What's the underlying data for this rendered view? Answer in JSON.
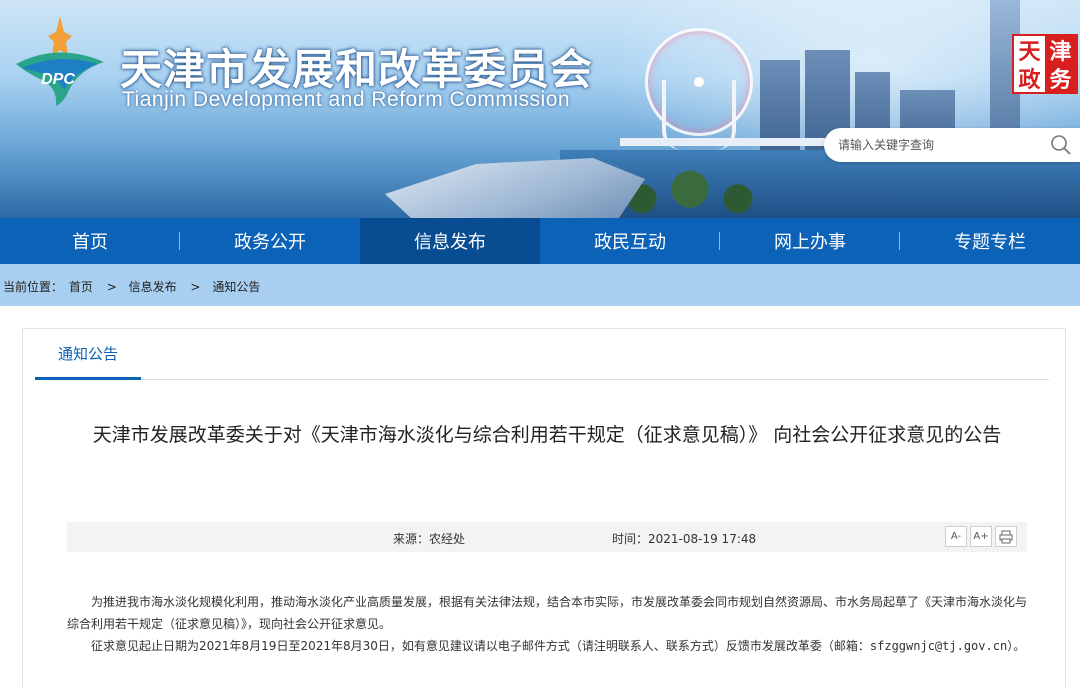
{
  "header": {
    "logo_text": "DPC",
    "title_cn": "天津市发展和改革委员会",
    "title_en": "Tianjin Development and Reform Commission",
    "seal_chars": [
      "天",
      "津",
      "政",
      "务"
    ]
  },
  "search": {
    "placeholder": "请输入关键字查询"
  },
  "nav": {
    "items": [
      {
        "label": "首页"
      },
      {
        "label": "政务公开"
      },
      {
        "label": "信息发布"
      },
      {
        "label": "政民互动"
      },
      {
        "label": "网上办事"
      },
      {
        "label": "专题专栏"
      }
    ],
    "active_index": 2
  },
  "breadcrumb": {
    "prefix": "当前位置：",
    "items": [
      "首页",
      "信息发布",
      "通知公告"
    ],
    "separator": ">"
  },
  "panel": {
    "tab_label": "通知公告"
  },
  "article": {
    "title": "天津市发展改革委关于对《天津市海水淡化与综合利用若干规定（征求意见稿）》 向社会公开征求意见的公告",
    "source": "来源：农经处",
    "time": "时间：2021-08-19 17:48",
    "tools": {
      "font_smaller": "A-",
      "font_larger": "A+"
    },
    "para1": "为推进我市海水淡化规模化利用，推动海水淡化产业高质量发展，根据有关法律法规，结合本市实际，市发展改革委会同市规划自然资源局、市水务局起草了《天津市海水淡化与综合利用若干规定（征求意见稿）》，现向社会公开征求意见。",
    "para2_main": "征求意见起止日期为2021年8月19日至2021年8月30日，如有意见建议请以电子邮件方式（请注明联系人、联系方式）反馈市发展改革委（邮箱：",
    "para2_email": "sfzggwnjc@tj.gov.cn",
    "para2_end": "）。"
  },
  "colors": {
    "nav_bg": "#0c62b7",
    "nav_active": "#084d91",
    "crumb_bg": "#a8cff0",
    "accent": "#0c62b7",
    "seal_red": "#d81e1e"
  }
}
